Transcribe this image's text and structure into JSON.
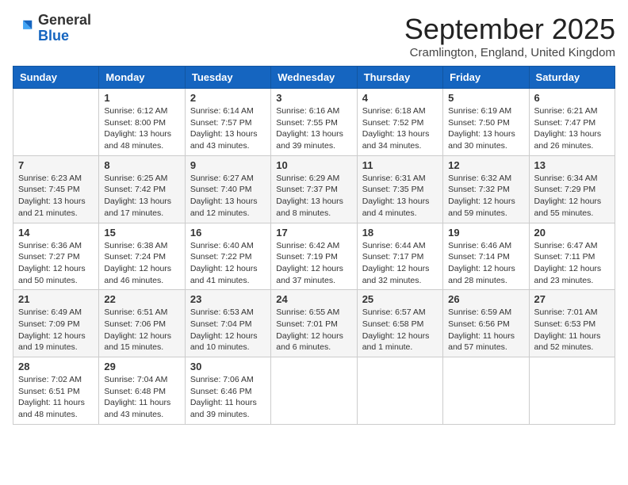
{
  "logo": {
    "general": "General",
    "blue": "Blue"
  },
  "header": {
    "month": "September 2025",
    "location": "Cramlington, England, United Kingdom"
  },
  "days_of_week": [
    "Sunday",
    "Monday",
    "Tuesday",
    "Wednesday",
    "Thursday",
    "Friday",
    "Saturday"
  ],
  "weeks": [
    [
      {
        "day": "",
        "info": ""
      },
      {
        "day": "1",
        "info": "Sunrise: 6:12 AM\nSunset: 8:00 PM\nDaylight: 13 hours and 48 minutes."
      },
      {
        "day": "2",
        "info": "Sunrise: 6:14 AM\nSunset: 7:57 PM\nDaylight: 13 hours and 43 minutes."
      },
      {
        "day": "3",
        "info": "Sunrise: 6:16 AM\nSunset: 7:55 PM\nDaylight: 13 hours and 39 minutes."
      },
      {
        "day": "4",
        "info": "Sunrise: 6:18 AM\nSunset: 7:52 PM\nDaylight: 13 hours and 34 minutes."
      },
      {
        "day": "5",
        "info": "Sunrise: 6:19 AM\nSunset: 7:50 PM\nDaylight: 13 hours and 30 minutes."
      },
      {
        "day": "6",
        "info": "Sunrise: 6:21 AM\nSunset: 7:47 PM\nDaylight: 13 hours and 26 minutes."
      }
    ],
    [
      {
        "day": "7",
        "info": "Sunrise: 6:23 AM\nSunset: 7:45 PM\nDaylight: 13 hours and 21 minutes."
      },
      {
        "day": "8",
        "info": "Sunrise: 6:25 AM\nSunset: 7:42 PM\nDaylight: 13 hours and 17 minutes."
      },
      {
        "day": "9",
        "info": "Sunrise: 6:27 AM\nSunset: 7:40 PM\nDaylight: 13 hours and 12 minutes."
      },
      {
        "day": "10",
        "info": "Sunrise: 6:29 AM\nSunset: 7:37 PM\nDaylight: 13 hours and 8 minutes."
      },
      {
        "day": "11",
        "info": "Sunrise: 6:31 AM\nSunset: 7:35 PM\nDaylight: 13 hours and 4 minutes."
      },
      {
        "day": "12",
        "info": "Sunrise: 6:32 AM\nSunset: 7:32 PM\nDaylight: 12 hours and 59 minutes."
      },
      {
        "day": "13",
        "info": "Sunrise: 6:34 AM\nSunset: 7:29 PM\nDaylight: 12 hours and 55 minutes."
      }
    ],
    [
      {
        "day": "14",
        "info": "Sunrise: 6:36 AM\nSunset: 7:27 PM\nDaylight: 12 hours and 50 minutes."
      },
      {
        "day": "15",
        "info": "Sunrise: 6:38 AM\nSunset: 7:24 PM\nDaylight: 12 hours and 46 minutes."
      },
      {
        "day": "16",
        "info": "Sunrise: 6:40 AM\nSunset: 7:22 PM\nDaylight: 12 hours and 41 minutes."
      },
      {
        "day": "17",
        "info": "Sunrise: 6:42 AM\nSunset: 7:19 PM\nDaylight: 12 hours and 37 minutes."
      },
      {
        "day": "18",
        "info": "Sunrise: 6:44 AM\nSunset: 7:17 PM\nDaylight: 12 hours and 32 minutes."
      },
      {
        "day": "19",
        "info": "Sunrise: 6:46 AM\nSunset: 7:14 PM\nDaylight: 12 hours and 28 minutes."
      },
      {
        "day": "20",
        "info": "Sunrise: 6:47 AM\nSunset: 7:11 PM\nDaylight: 12 hours and 23 minutes."
      }
    ],
    [
      {
        "day": "21",
        "info": "Sunrise: 6:49 AM\nSunset: 7:09 PM\nDaylight: 12 hours and 19 minutes."
      },
      {
        "day": "22",
        "info": "Sunrise: 6:51 AM\nSunset: 7:06 PM\nDaylight: 12 hours and 15 minutes."
      },
      {
        "day": "23",
        "info": "Sunrise: 6:53 AM\nSunset: 7:04 PM\nDaylight: 12 hours and 10 minutes."
      },
      {
        "day": "24",
        "info": "Sunrise: 6:55 AM\nSunset: 7:01 PM\nDaylight: 12 hours and 6 minutes."
      },
      {
        "day": "25",
        "info": "Sunrise: 6:57 AM\nSunset: 6:58 PM\nDaylight: 12 hours and 1 minute."
      },
      {
        "day": "26",
        "info": "Sunrise: 6:59 AM\nSunset: 6:56 PM\nDaylight: 11 hours and 57 minutes."
      },
      {
        "day": "27",
        "info": "Sunrise: 7:01 AM\nSunset: 6:53 PM\nDaylight: 11 hours and 52 minutes."
      }
    ],
    [
      {
        "day": "28",
        "info": "Sunrise: 7:02 AM\nSunset: 6:51 PM\nDaylight: 11 hours and 48 minutes."
      },
      {
        "day": "29",
        "info": "Sunrise: 7:04 AM\nSunset: 6:48 PM\nDaylight: 11 hours and 43 minutes."
      },
      {
        "day": "30",
        "info": "Sunrise: 7:06 AM\nSunset: 6:46 PM\nDaylight: 11 hours and 39 minutes."
      },
      {
        "day": "",
        "info": ""
      },
      {
        "day": "",
        "info": ""
      },
      {
        "day": "",
        "info": ""
      },
      {
        "day": "",
        "info": ""
      }
    ]
  ]
}
